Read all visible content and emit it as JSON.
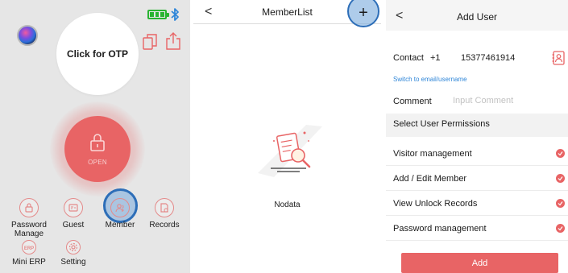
{
  "home": {
    "otp_label": "Click for OTP",
    "open_label": "OPEN",
    "grid": [
      {
        "label": "Password Manage",
        "icon": "lock-circle-icon"
      },
      {
        "label": "Guest",
        "icon": "guest-card-icon"
      },
      {
        "label": "Member",
        "icon": "member-icon"
      },
      {
        "label": "Records",
        "icon": "records-icon"
      },
      {
        "label": "Mini ERP",
        "icon": "erp-icon"
      },
      {
        "label": "Setting",
        "icon": "gear-icon"
      }
    ],
    "accent": "#e86465",
    "battery_color": "#29b431",
    "bluetooth_color": "#2f86d8"
  },
  "member_list": {
    "back": "<",
    "title": "MemberList",
    "add": "+",
    "empty_text": "Nodata"
  },
  "add_user": {
    "back": "<",
    "title": "Add User",
    "contact_label": "Contact",
    "country_code": "+1",
    "phone": "15377461914",
    "switch_link": "Switch to email/username",
    "comment_label": "Comment",
    "comment_placeholder": "Input Comment",
    "permissions_title": "Select User Permissions",
    "permissions": [
      {
        "label": "Visitor management",
        "checked": true
      },
      {
        "label": "Add / Edit Member",
        "checked": true
      },
      {
        "label": "View Unlock Records",
        "checked": true
      },
      {
        "label": "Password management",
        "checked": true
      }
    ],
    "add_button": "Add"
  }
}
